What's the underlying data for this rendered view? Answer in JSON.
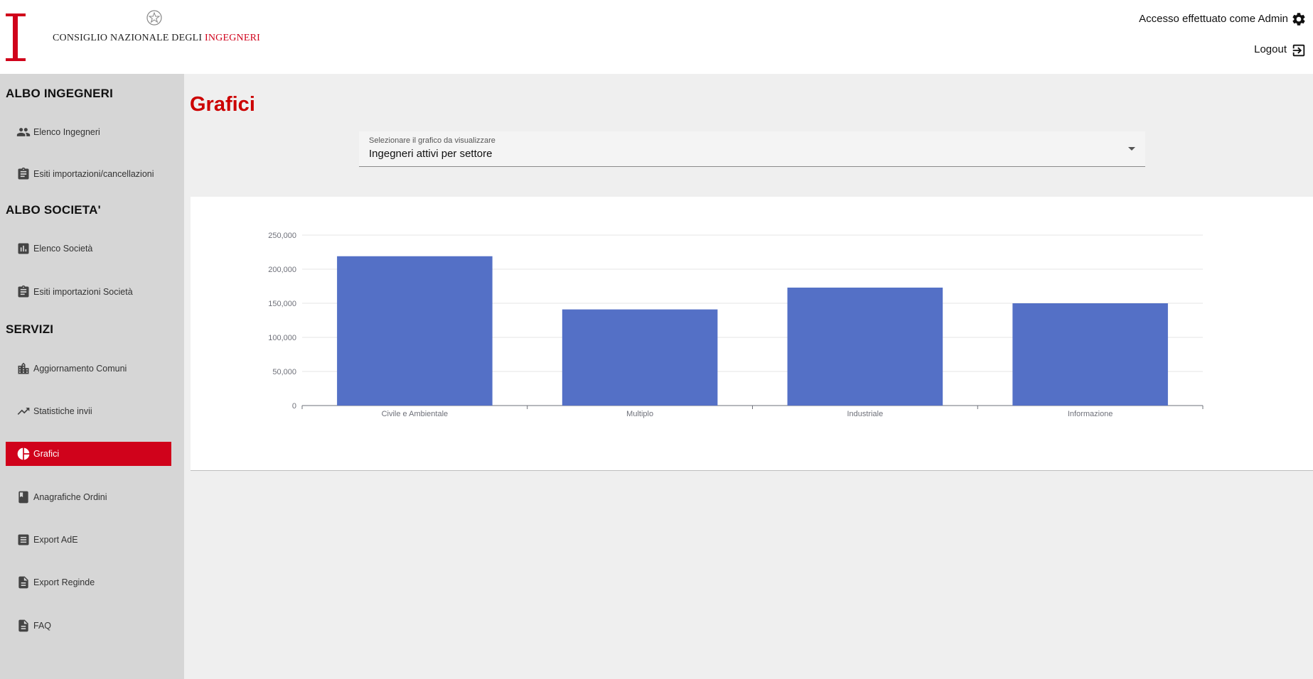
{
  "header": {
    "org_name_prefix": "CONSIGLIO NAZIONALE DEGLI ",
    "org_name_accent": "INGEGNERI",
    "user_status": "Accesso effettuato come Admin",
    "logout_label": "Logout",
    "accent_color": "#d0021b"
  },
  "sidebar": {
    "sections": [
      {
        "title": "ALBO INGEGNERI"
      },
      {
        "title": "ALBO SOCIETA'"
      },
      {
        "title": "SERVIZI"
      }
    ],
    "items": [
      {
        "label": "Elenco Ingegneri",
        "icon": "people-icon"
      },
      {
        "label": "Esiti importazioni/cancellazioni",
        "icon": "clipboard-icon"
      },
      {
        "label": "Elenco Società",
        "icon": "bar-chart-icon"
      },
      {
        "label": "Esiti importazioni Società",
        "icon": "clipboard-icon"
      },
      {
        "label": "Aggiornamento Comuni",
        "icon": "building-icon"
      },
      {
        "label": "Statistiche invii",
        "icon": "trending-up-icon"
      },
      {
        "label": "Grafici",
        "icon": "pie-chart-icon",
        "active": true
      },
      {
        "label": "Anagrafiche Ordini",
        "icon": "book-icon"
      },
      {
        "label": "Export AdE",
        "icon": "list-icon"
      },
      {
        "label": "Export Reginde",
        "icon": "document-icon"
      },
      {
        "label": "FAQ",
        "icon": "document-icon"
      }
    ]
  },
  "main": {
    "title": "Grafici",
    "select": {
      "label": "Selezionare il grafico da visualizzare",
      "value": "Ingegneri attivi per settore"
    }
  },
  "chart_data": {
    "type": "bar",
    "categories": [
      "Civile e Ambientale",
      "Multiplo",
      "Industriale",
      "Informazione"
    ],
    "values": [
      219000,
      141000,
      173000,
      150000
    ],
    "ylim": [
      0,
      250000
    ],
    "yticks": [
      "0",
      "50,000",
      "100,000",
      "150,000",
      "200,000",
      "250,000"
    ],
    "ytick_values": [
      0,
      50000,
      100000,
      150000,
      200000,
      250000
    ],
    "bar_color": "#5470c6",
    "grid": true,
    "legend": "none"
  }
}
